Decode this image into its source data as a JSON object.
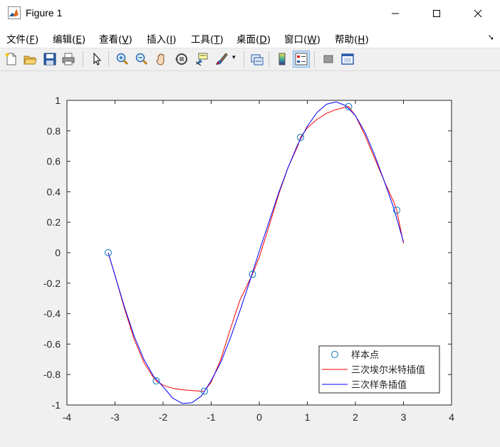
{
  "window": {
    "title": "Figure 1"
  },
  "menu": [
    {
      "label": "文件(",
      "key": "F",
      "end": ")"
    },
    {
      "label": "编辑(",
      "key": "E",
      "end": ")"
    },
    {
      "label": "查看(",
      "key": "V",
      "end": ")"
    },
    {
      "label": "插入(",
      "key": "I",
      "end": ")"
    },
    {
      "label": "工具(",
      "key": "T",
      "end": ")"
    },
    {
      "label": "桌面(",
      "key": "D",
      "end": ")"
    },
    {
      "label": "窗口(",
      "key": "W",
      "end": ")"
    },
    {
      "label": "帮助(",
      "key": "H",
      "end": ")"
    }
  ],
  "toolbar": [
    "new-figure-icon",
    "open-file-icon",
    "save-icon",
    "print-icon",
    "pointer-icon",
    "zoom-in-icon",
    "zoom-out-icon",
    "pan-hand-icon",
    "rotate-3d-icon",
    "data-cursor-icon",
    "brush-icon",
    "link-plot-icon",
    "colorbar-icon",
    "legend-icon",
    "hide-plot-tools-icon",
    "show-plot-tools-icon"
  ],
  "colors": {
    "sample": "#0072bd",
    "hermite": "#ff0000",
    "spline": "#0000ff"
  },
  "chart_data": {
    "type": "line",
    "title": "",
    "xlabel": "",
    "ylabel": "",
    "xlim": [
      -4,
      4
    ],
    "ylim": [
      -1,
      1
    ],
    "xticks": [
      "-4",
      "-3",
      "-2",
      "-1",
      "0",
      "1",
      "2",
      "3",
      "4"
    ],
    "yticks": [
      "-1",
      "-0.8",
      "-0.6",
      "-0.4",
      "-0.2",
      "0",
      "0.2",
      "0.4",
      "0.6",
      "0.8",
      "1"
    ],
    "grid": false,
    "legend_position": "bottom-right",
    "series": [
      {
        "name": "样本点",
        "style": "markers-circle",
        "x": [
          -3.1416,
          -2.1416,
          -1.1416,
          -0.1416,
          0.8584,
          1.8584,
          2.8584
        ],
        "y": [
          0.0,
          -0.8415,
          -0.9093,
          -0.1411,
          0.7568,
          0.9589,
          0.2794
        ]
      },
      {
        "name": "三次埃尔米特插值",
        "style": "line",
        "x": [
          -3.1416,
          -3.0,
          -2.8,
          -2.6,
          -2.4,
          -2.2,
          -2.1416,
          -2.0,
          -1.8,
          -1.6,
          -1.4,
          -1.2,
          -1.1416,
          -1.0,
          -0.8,
          -0.6,
          -0.4,
          -0.2,
          -0.1416,
          0.0,
          0.2,
          0.4,
          0.6,
          0.8,
          0.8584,
          1.0,
          1.2,
          1.4,
          1.6,
          1.8,
          1.8584,
          2.0,
          2.2,
          2.4,
          2.6,
          2.8,
          2.8584,
          3.0
        ],
        "y": [
          0.0,
          -0.15,
          -0.37,
          -0.57,
          -0.72,
          -0.82,
          -0.8415,
          -0.87,
          -0.89,
          -0.9,
          -0.905,
          -0.91,
          -0.9093,
          -0.85,
          -0.7,
          -0.5,
          -0.31,
          -0.18,
          -0.1411,
          -0.03,
          0.17,
          0.38,
          0.56,
          0.7,
          0.7568,
          0.82,
          0.875,
          0.915,
          0.94,
          0.955,
          0.9589,
          0.9,
          0.77,
          0.62,
          0.47,
          0.33,
          0.2794,
          0.06
        ]
      },
      {
        "name": "三次样条插值",
        "style": "line",
        "x": [
          -3.1416,
          -3.0,
          -2.8,
          -2.6,
          -2.4,
          -2.2,
          -2.0,
          -1.8,
          -1.6,
          -1.4,
          -1.2,
          -1.0,
          -0.8,
          -0.6,
          -0.4,
          -0.2,
          0.0,
          0.2,
          0.4,
          0.6,
          0.8,
          1.0,
          1.2,
          1.4,
          1.6,
          1.8,
          2.0,
          2.2,
          2.4,
          2.6,
          2.8,
          3.0
        ],
        "y": [
          0.0,
          -0.15,
          -0.36,
          -0.55,
          -0.7,
          -0.81,
          -0.88,
          -0.955,
          -0.99,
          -0.985,
          -0.94,
          -0.84,
          -0.72,
          -0.56,
          -0.38,
          -0.19,
          0.01,
          0.2,
          0.39,
          0.56,
          0.71,
          0.83,
          0.92,
          0.975,
          0.99,
          0.965,
          0.9,
          0.79,
          0.64,
          0.47,
          0.29,
          0.07
        ]
      }
    ]
  }
}
